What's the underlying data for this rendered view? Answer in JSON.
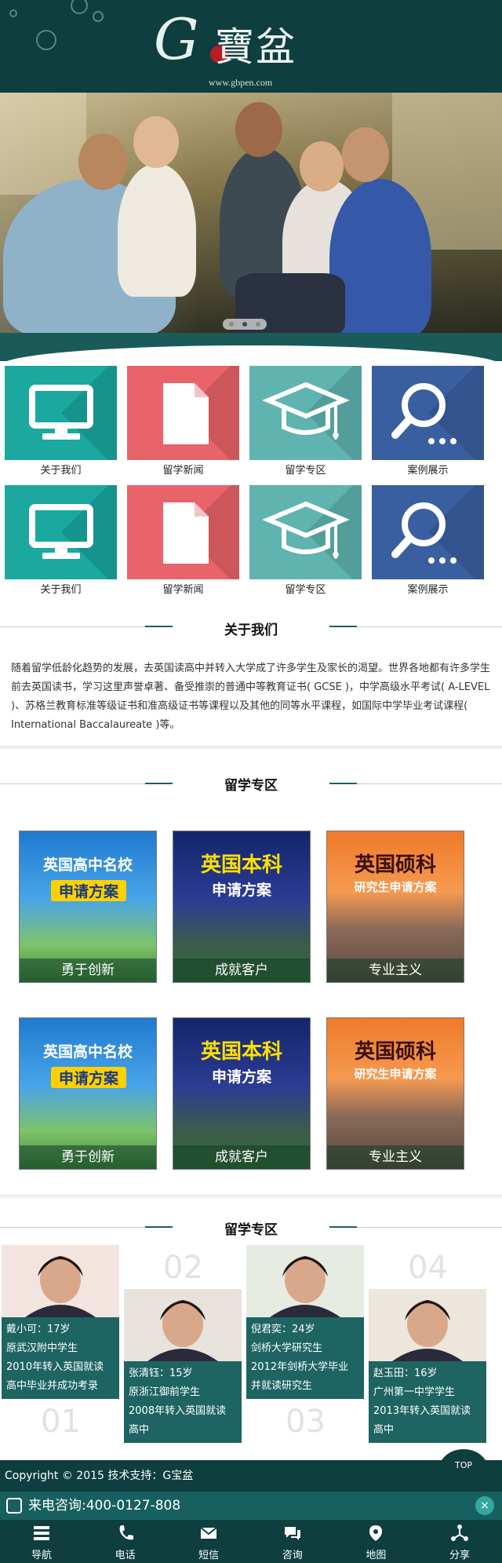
{
  "header": {
    "logo_letter": "G",
    "logo_text": "寶盆",
    "logo_url": "www.gbpen.com"
  },
  "banner": {
    "slides": 3,
    "active_slide": 2
  },
  "tiles": [
    {
      "label": "关于我们",
      "color": "#1aa89f",
      "icon": "monitor-icon"
    },
    {
      "label": "留学新闻",
      "color": "#e8636a",
      "icon": "document-icon"
    },
    {
      "label": "留学专区",
      "color": "#5fb4b0",
      "icon": "graduation-cap-icon"
    },
    {
      "label": "案例展示",
      "color": "#3a5fa0",
      "icon": "search-icon"
    },
    {
      "label": "关于我们",
      "color": "#1aa89f",
      "icon": "monitor-icon"
    },
    {
      "label": "留学新闻",
      "color": "#e8636a",
      "icon": "document-icon"
    },
    {
      "label": "留学专区",
      "color": "#5fb4b0",
      "icon": "graduation-cap-icon"
    },
    {
      "label": "案例展示",
      "color": "#3a5fa0",
      "icon": "search-icon"
    }
  ],
  "about": {
    "title": "关于我们",
    "text": "随着留学低龄化趋势的发展，去英国读高中并转入大学成了许多学生及家长的渴望。世界各地都有许多学生前去英国读书，学习这里声誉卓著、备受推崇的普通中等教育证书( GCSE )，中学高级水平考试( A-LEVEL )、苏格兰教育标准等级证书和准高级证书等课程以及其他的同等水平课程，如国际中学毕业考试课程( International Baccalaureate )等。"
  },
  "programs": {
    "title": "留学专区",
    "items": [
      {
        "banner": "英国高中名校",
        "sub": "申请方案",
        "caption": "勇于创新"
      },
      {
        "banner": "英国本科",
        "sub": "申请方案",
        "caption": "成就客户"
      },
      {
        "banner": "英国硕科",
        "sub": "研究生申请方案",
        "caption": "专业主义"
      },
      {
        "banner": "英国高中名校",
        "sub": "申请方案",
        "caption": "勇于创新"
      },
      {
        "banner": "英国本科",
        "sub": "申请方案",
        "caption": "成就客户"
      },
      {
        "banner": "英国硕科",
        "sub": "研究生申请方案",
        "caption": "专业主义"
      }
    ]
  },
  "students": {
    "title": "留学专区",
    "items": [
      {
        "num": "01",
        "lines": [
          "戴小可：17岁",
          "原武汉附中学生",
          "2010年转入英国就读",
          "高中毕业并成功考录"
        ]
      },
      {
        "num": "02",
        "lines": [
          "张清钰：15岁",
          "原浙江御前学生",
          "2008年转入英国就读",
          "高中"
        ]
      },
      {
        "num": "03",
        "lines": [
          "倪君奕：24岁",
          "剑桥大学研究生",
          "2012年剑桥大学毕业",
          "并就读研究生"
        ]
      },
      {
        "num": "04",
        "lines": [
          "赵玉田：16岁",
          "广州第一中学学生",
          "2013年转入英国就读",
          "高中"
        ]
      }
    ]
  },
  "footer": {
    "copyright": "Copyright © 2015 技术支持：G宝盆",
    "top": "TOP"
  },
  "call": {
    "label": "来电咨询:",
    "phone": "400-0127-808",
    "close": "×"
  },
  "nav": [
    {
      "label": "导航",
      "icon": "menu-icon"
    },
    {
      "label": "电话",
      "icon": "phone-icon"
    },
    {
      "label": "短信",
      "icon": "envelope-icon"
    },
    {
      "label": "咨询",
      "icon": "chat-icon"
    },
    {
      "label": "地图",
      "icon": "map-pin-icon"
    },
    {
      "label": "分享",
      "icon": "share-icon"
    }
  ]
}
